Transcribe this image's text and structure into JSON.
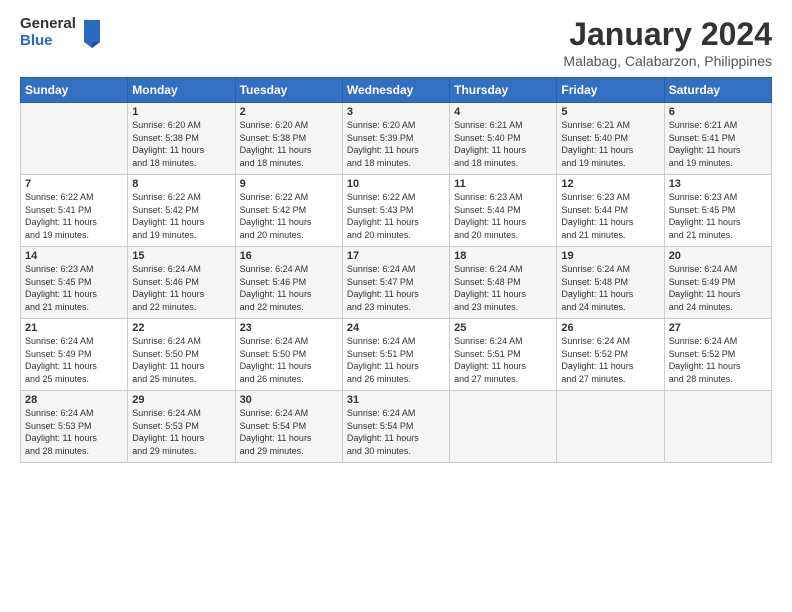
{
  "logo": {
    "general": "General",
    "blue": "Blue"
  },
  "title": "January 2024",
  "subtitle": "Malabag, Calabarzon, Philippines",
  "days_header": [
    "Sunday",
    "Monday",
    "Tuesday",
    "Wednesday",
    "Thursday",
    "Friday",
    "Saturday"
  ],
  "weeks": [
    [
      {
        "num": "",
        "info": ""
      },
      {
        "num": "1",
        "info": "Sunrise: 6:20 AM\nSunset: 5:38 PM\nDaylight: 11 hours\nand 18 minutes."
      },
      {
        "num": "2",
        "info": "Sunrise: 6:20 AM\nSunset: 5:38 PM\nDaylight: 11 hours\nand 18 minutes."
      },
      {
        "num": "3",
        "info": "Sunrise: 6:20 AM\nSunset: 5:39 PM\nDaylight: 11 hours\nand 18 minutes."
      },
      {
        "num": "4",
        "info": "Sunrise: 6:21 AM\nSunset: 5:40 PM\nDaylight: 11 hours\nand 18 minutes."
      },
      {
        "num": "5",
        "info": "Sunrise: 6:21 AM\nSunset: 5:40 PM\nDaylight: 11 hours\nand 19 minutes."
      },
      {
        "num": "6",
        "info": "Sunrise: 6:21 AM\nSunset: 5:41 PM\nDaylight: 11 hours\nand 19 minutes."
      }
    ],
    [
      {
        "num": "7",
        "info": "Sunrise: 6:22 AM\nSunset: 5:41 PM\nDaylight: 11 hours\nand 19 minutes."
      },
      {
        "num": "8",
        "info": "Sunrise: 6:22 AM\nSunset: 5:42 PM\nDaylight: 11 hours\nand 19 minutes."
      },
      {
        "num": "9",
        "info": "Sunrise: 6:22 AM\nSunset: 5:42 PM\nDaylight: 11 hours\nand 20 minutes."
      },
      {
        "num": "10",
        "info": "Sunrise: 6:22 AM\nSunset: 5:43 PM\nDaylight: 11 hours\nand 20 minutes."
      },
      {
        "num": "11",
        "info": "Sunrise: 6:23 AM\nSunset: 5:44 PM\nDaylight: 11 hours\nand 20 minutes."
      },
      {
        "num": "12",
        "info": "Sunrise: 6:23 AM\nSunset: 5:44 PM\nDaylight: 11 hours\nand 21 minutes."
      },
      {
        "num": "13",
        "info": "Sunrise: 6:23 AM\nSunset: 5:45 PM\nDaylight: 11 hours\nand 21 minutes."
      }
    ],
    [
      {
        "num": "14",
        "info": "Sunrise: 6:23 AM\nSunset: 5:45 PM\nDaylight: 11 hours\nand 21 minutes."
      },
      {
        "num": "15",
        "info": "Sunrise: 6:24 AM\nSunset: 5:46 PM\nDaylight: 11 hours\nand 22 minutes."
      },
      {
        "num": "16",
        "info": "Sunrise: 6:24 AM\nSunset: 5:46 PM\nDaylight: 11 hours\nand 22 minutes."
      },
      {
        "num": "17",
        "info": "Sunrise: 6:24 AM\nSunset: 5:47 PM\nDaylight: 11 hours\nand 23 minutes."
      },
      {
        "num": "18",
        "info": "Sunrise: 6:24 AM\nSunset: 5:48 PM\nDaylight: 11 hours\nand 23 minutes."
      },
      {
        "num": "19",
        "info": "Sunrise: 6:24 AM\nSunset: 5:48 PM\nDaylight: 11 hours\nand 24 minutes."
      },
      {
        "num": "20",
        "info": "Sunrise: 6:24 AM\nSunset: 5:49 PM\nDaylight: 11 hours\nand 24 minutes."
      }
    ],
    [
      {
        "num": "21",
        "info": "Sunrise: 6:24 AM\nSunset: 5:49 PM\nDaylight: 11 hours\nand 25 minutes."
      },
      {
        "num": "22",
        "info": "Sunrise: 6:24 AM\nSunset: 5:50 PM\nDaylight: 11 hours\nand 25 minutes."
      },
      {
        "num": "23",
        "info": "Sunrise: 6:24 AM\nSunset: 5:50 PM\nDaylight: 11 hours\nand 26 minutes."
      },
      {
        "num": "24",
        "info": "Sunrise: 6:24 AM\nSunset: 5:51 PM\nDaylight: 11 hours\nand 26 minutes."
      },
      {
        "num": "25",
        "info": "Sunrise: 6:24 AM\nSunset: 5:51 PM\nDaylight: 11 hours\nand 27 minutes."
      },
      {
        "num": "26",
        "info": "Sunrise: 6:24 AM\nSunset: 5:52 PM\nDaylight: 11 hours\nand 27 minutes."
      },
      {
        "num": "27",
        "info": "Sunrise: 6:24 AM\nSunset: 5:52 PM\nDaylight: 11 hours\nand 28 minutes."
      }
    ],
    [
      {
        "num": "28",
        "info": "Sunrise: 6:24 AM\nSunset: 5:53 PM\nDaylight: 11 hours\nand 28 minutes."
      },
      {
        "num": "29",
        "info": "Sunrise: 6:24 AM\nSunset: 5:53 PM\nDaylight: 11 hours\nand 29 minutes."
      },
      {
        "num": "30",
        "info": "Sunrise: 6:24 AM\nSunset: 5:54 PM\nDaylight: 11 hours\nand 29 minutes."
      },
      {
        "num": "31",
        "info": "Sunrise: 6:24 AM\nSunset: 5:54 PM\nDaylight: 11 hours\nand 30 minutes."
      },
      {
        "num": "",
        "info": ""
      },
      {
        "num": "",
        "info": ""
      },
      {
        "num": "",
        "info": ""
      }
    ]
  ]
}
